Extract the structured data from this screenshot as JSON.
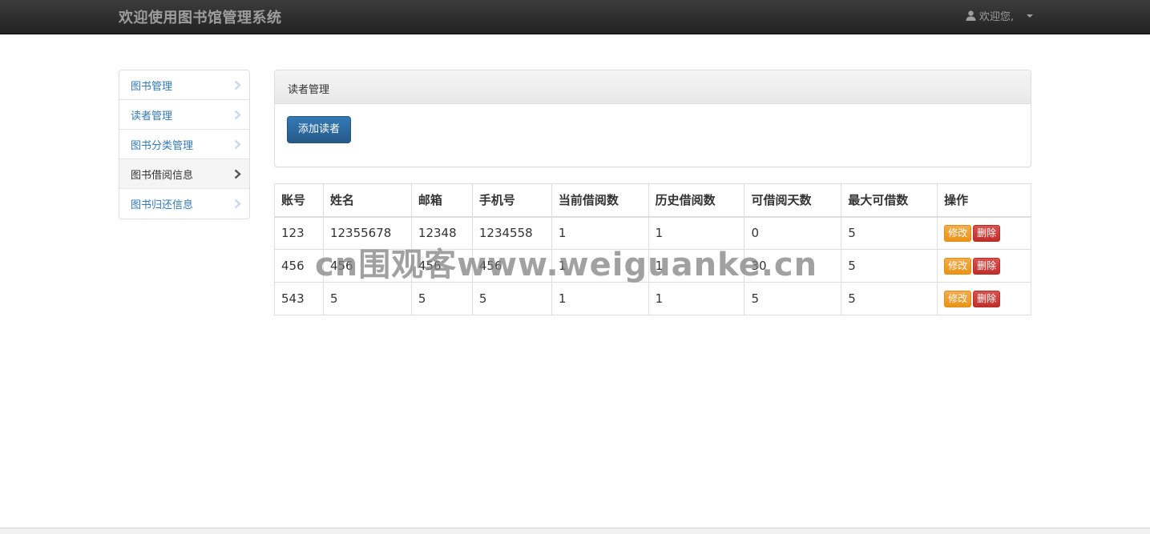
{
  "navbar": {
    "brand": "欢迎使用图书馆管理系统",
    "user_icon": "user-icon",
    "welcome": "欢迎您,"
  },
  "sidebar": {
    "items": [
      {
        "label": "图书管理",
        "active": false
      },
      {
        "label": "读者管理",
        "active": false
      },
      {
        "label": "图书分类管理",
        "active": false
      },
      {
        "label": "图书借阅信息",
        "active": true
      },
      {
        "label": "图书归还信息",
        "active": false
      }
    ]
  },
  "panel": {
    "title": "读者管理",
    "add_button": "添加读者"
  },
  "table": {
    "headers": [
      "账号",
      "姓名",
      "邮箱",
      "手机号",
      "当前借阅数",
      "历史借阅数",
      "可借阅天数",
      "最大可借数",
      "操作"
    ],
    "rows": [
      [
        "123",
        "12355678",
        "12348",
        "1234558",
        "1",
        "1",
        "0",
        "5"
      ],
      [
        "456",
        "456",
        "456",
        "456",
        "1",
        "1",
        "30",
        "5"
      ],
      [
        "543",
        "5",
        "5",
        "5",
        "1",
        "1",
        "5",
        "5"
      ]
    ],
    "edit_label": "修改",
    "delete_label": "删除"
  },
  "watermark": "cn围观客www.weiguanke.cn",
  "colors": {
    "navbar": "#222222",
    "primary": "#337ab7",
    "warning": "#f0ad4e",
    "danger": "#d9534f"
  }
}
